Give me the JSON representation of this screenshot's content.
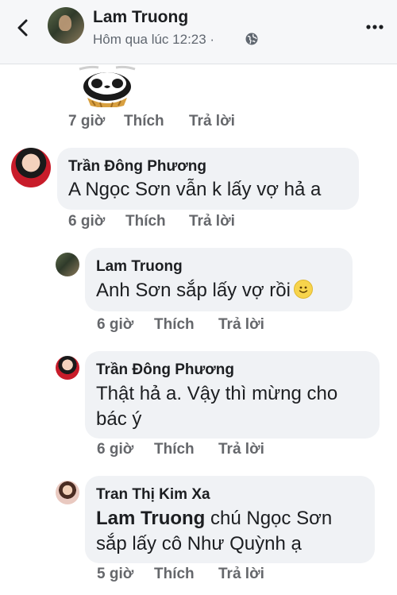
{
  "header": {
    "back_icon": "chevron-left-icon",
    "name": "Lam Truong",
    "timestamp": "Hôm qua lúc 12:23 ·",
    "privacy_icon": "globe-icon",
    "more_icon": "more-horizontal-icon"
  },
  "comments": [
    {
      "id": "sticker-comment",
      "sticker": "panda-sticker",
      "time": "7 giờ",
      "like": "Thích",
      "reply": "Trả lời"
    },
    {
      "id": "c1",
      "author": "Trần Đông Phương",
      "text": "A Ngọc Sơn vẫn k lấy vợ hả a",
      "time": "6 giờ",
      "like": "Thích",
      "reply": "Trả lời"
    },
    {
      "id": "c2",
      "author": "Lam Truong",
      "text": "Anh Sơn sắp lấy vợ rồi",
      "emoji": "smile-emoji-icon",
      "time": "6 giờ",
      "like": "Thích",
      "reply": "Trả lời"
    },
    {
      "id": "c3",
      "author": "Trần Đông Phương",
      "text_line1": "Thật hả a. Vậy thì mừng cho",
      "text_line2": "bác ý",
      "time": "6 giờ",
      "like": "Thích",
      "reply": "Trả lời"
    },
    {
      "id": "c4",
      "author": "Tran Thị Kim Xa",
      "mention": "Lam Truong",
      "text_line1_rest": " chú Ngọc Sơn",
      "text_line2": "sắp lấy cô Như Quỳnh ạ",
      "time": "5 giờ",
      "like": "Thích",
      "reply": "Trả lời"
    }
  ],
  "colors": {
    "header_bg": "#f6f7f9",
    "bubble_bg": "#f0f2f5",
    "meta_text": "#65676b"
  }
}
